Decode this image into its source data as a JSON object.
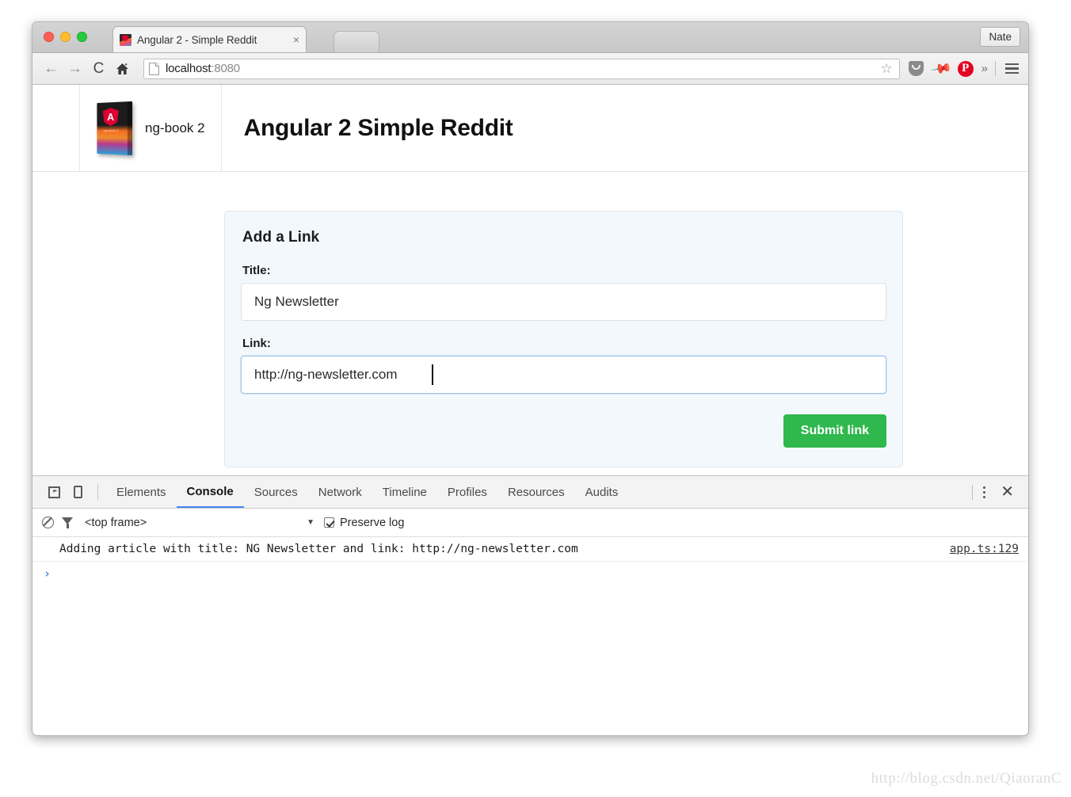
{
  "browser": {
    "tab": {
      "title": "Angular 2 - Simple Reddit",
      "close_label": "×",
      "favicon_name": "ng-book-favicon"
    },
    "profile_button": "Nate",
    "toolbar": {
      "back": "←",
      "forward": "→",
      "reload": "C",
      "home": "⌂",
      "url": "localhost",
      "url_port": ":8080",
      "star": "☆",
      "overflow": "»"
    }
  },
  "page": {
    "brand_label": "ng-book 2",
    "book_cover_text": "ng-book 2",
    "site_title": "Angular 2 Simple Reddit",
    "form": {
      "panel_title": "Add a Link",
      "title_label": "Title:",
      "title_value": "Ng Newsletter",
      "title_placeholder": "",
      "link_label": "Link:",
      "link_value": "http://ng-newsletter.com",
      "link_placeholder": "",
      "submit_label": "Submit link",
      "submit_color": "#2fb84d"
    }
  },
  "devtools": {
    "tabs": [
      {
        "label": "Elements",
        "active": false
      },
      {
        "label": "Console",
        "active": true
      },
      {
        "label": "Sources",
        "active": false
      },
      {
        "label": "Network",
        "active": false
      },
      {
        "label": "Timeline",
        "active": false
      },
      {
        "label": "Profiles",
        "active": false
      },
      {
        "label": "Resources",
        "active": false
      },
      {
        "label": "Audits",
        "active": false
      }
    ],
    "active_tab_color": "#4285f4",
    "close_label": "✕",
    "filterbar": {
      "frame_value": "<top frame>",
      "frame_caret": "▼",
      "preserve_log_label": "Preserve log",
      "preserve_log_checked": true
    },
    "console": {
      "message": "Adding article with title: NG Newsletter and link: http://ng-newsletter.com",
      "source": "app.ts:129",
      "prompt": "›"
    }
  },
  "watermark": "http://blog.csdn.net/QiaoranC"
}
